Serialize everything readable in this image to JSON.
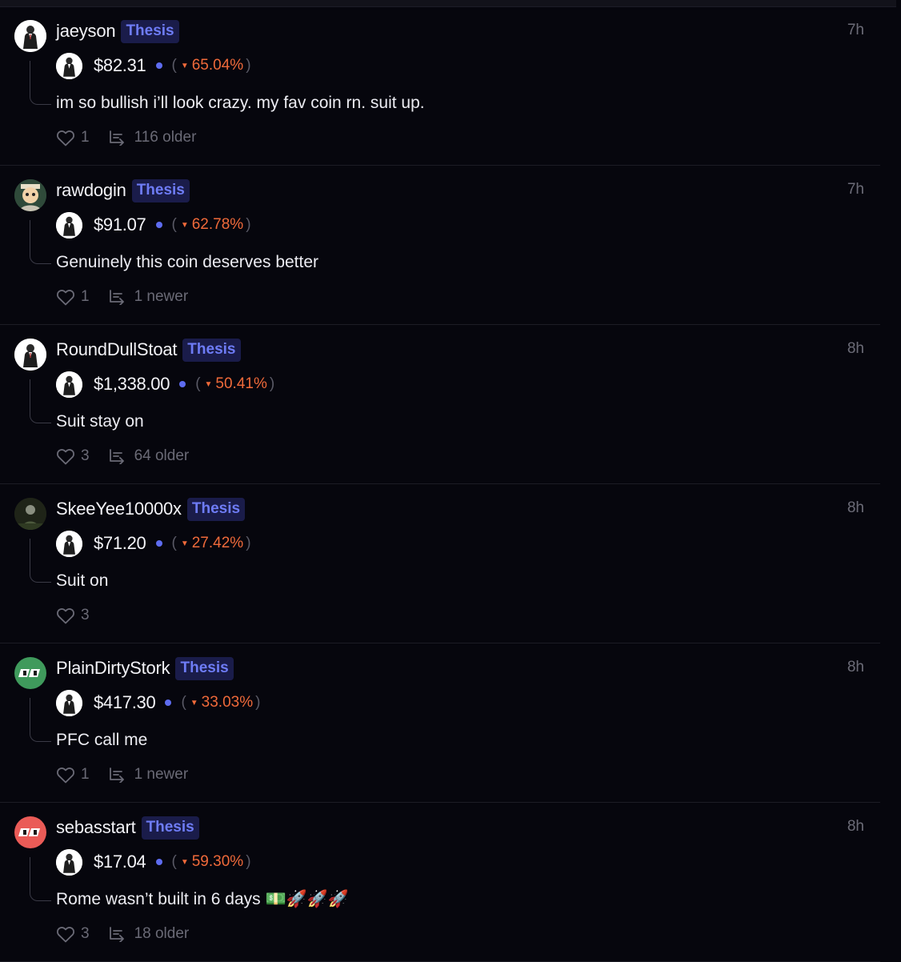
{
  "posts": [
    {
      "username": "jaeyson",
      "badge": "Thesis",
      "time": "7h",
      "avatar_icon": "suit-figure-avatar",
      "avatar_bg": "#ffffff",
      "price": "$82.31",
      "change_open": "(",
      "change_pct": "65.04%",
      "change_close": ")",
      "text": "im so bullish i’ll look crazy. my fav coin rn. suit up.",
      "likes": "1",
      "thread_label": "116 older"
    },
    {
      "username": "rawdogin",
      "badge": "Thesis",
      "time": "7h",
      "avatar_icon": "cartoon-character-avatar",
      "avatar_bg": "#2f4a3a",
      "price": "$91.07",
      "change_open": "(",
      "change_pct": "62.78%",
      "change_close": ")",
      "text": "Genuinely this coin deserves better",
      "likes": "1",
      "thread_label": "1 newer"
    },
    {
      "username": "RoundDullStoat",
      "badge": "Thesis",
      "time": "8h",
      "avatar_icon": "suit-figure-avatar",
      "avatar_bg": "#ffffff",
      "price": "$1,338.00",
      "change_open": "(",
      "change_pct": "50.41%",
      "change_close": ")",
      "text": "Suit stay on",
      "likes": "3",
      "thread_label": "64 older"
    },
    {
      "username": "SkeeYee10000x",
      "badge": "Thesis",
      "time": "8h",
      "avatar_icon": "dark-photo-avatar",
      "avatar_bg": "#1f2418",
      "price": "$71.20",
      "change_open": "(",
      "change_pct": "27.42%",
      "change_close": ")",
      "text": "Suit on",
      "likes": "3",
      "thread_label": ""
    },
    {
      "username": "PlainDirtyStork",
      "badge": "Thesis",
      "time": "8h",
      "avatar_icon": "eyes-logo-avatar",
      "avatar_bg": "#3f9a5c",
      "price": "$417.30",
      "change_open": "(",
      "change_pct": "33.03%",
      "change_close": ")",
      "text": "PFC call me",
      "likes": "1",
      "thread_label": "1 newer"
    },
    {
      "username": "sebasstart",
      "badge": "Thesis",
      "time": "8h",
      "avatar_icon": "eyes-logo-avatar",
      "avatar_bg": "#ea5b57",
      "price": "$17.04",
      "change_open": "(",
      "change_pct": "59.30%",
      "change_close": ")",
      "text": "Rome wasn’t built in 6 days 💵🚀🚀🚀",
      "likes": "3",
      "thread_label": "18 older"
    }
  ],
  "icons": {
    "like": "heart-icon",
    "thread": "thread-reply-icon",
    "coin": "suit-figure-coin-icon",
    "change_direction": "down-triangle-icon"
  },
  "colors": {
    "background": "#06060d",
    "badge_bg": "#1a1c4a",
    "badge_text": "#6e7cf6",
    "negative": "#f06a3a",
    "dot": "#5e6cf0"
  }
}
